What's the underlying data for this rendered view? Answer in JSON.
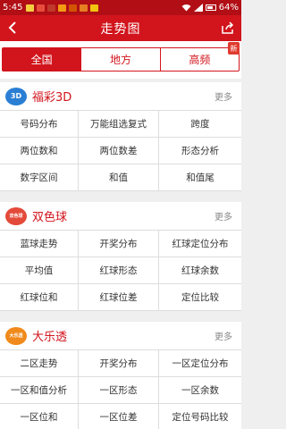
{
  "status": {
    "time": "5:45",
    "battery": "64%"
  },
  "header": {
    "title": "走势图"
  },
  "tabs": [
    {
      "label": "全国",
      "active": true
    },
    {
      "label": "地方",
      "active": false
    },
    {
      "label": "高频",
      "active": false,
      "badge": "新"
    }
  ],
  "sections": [
    {
      "logo_text": "3D",
      "name": "福彩3D",
      "more": "更多",
      "items": [
        "号码分布",
        "万能组选复式",
        "跨度",
        "两位数和",
        "两位数差",
        "形态分析",
        "数字区间",
        "和值",
        "和值尾"
      ]
    },
    {
      "logo_text": "双色球",
      "name": "双色球",
      "more": "更多",
      "items": [
        "蓝球走势",
        "开奖分布",
        "红球定位分布",
        "平均值",
        "红球形态",
        "红球余数",
        "红球位和",
        "红球位差",
        "定位比较"
      ]
    },
    {
      "logo_text": "大乐透",
      "name": "大乐透",
      "more": "更多",
      "items": [
        "二区走势",
        "开奖分布",
        "一区定位分布",
        "一区和值分析",
        "一区形态",
        "一区余数",
        "一区位和",
        "一区位差",
        "定位号码比较"
      ]
    }
  ],
  "colors": {
    "primary": "#d2141c",
    "status_bar": "#b10e15",
    "logo_3d": "#2a7fd4",
    "logo_ssq": "#e34a3a",
    "logo_dlt": "#f08a1c"
  }
}
